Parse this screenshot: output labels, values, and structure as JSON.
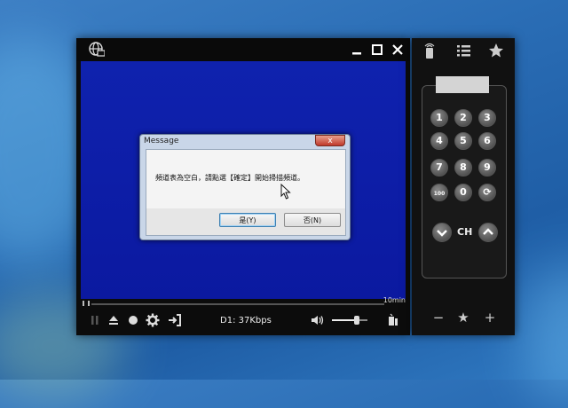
{
  "player": {
    "title_icon": "globe-tv-icon",
    "window_buttons": [
      "minimize-icon",
      "maximize-icon",
      "close-icon"
    ],
    "duration_label": "10min",
    "bitrate": "D1: 37Kbps",
    "seek_progress": 0.0,
    "volume_level": 0.7
  },
  "dialog": {
    "title": "Message",
    "close_label": "x",
    "message": "頻道表為空白，請點選【確定】開始掃描頻道。",
    "yes_label": "是(Y)",
    "no_label": "否(N)"
  },
  "remote": {
    "top_icons": [
      "remote-icon",
      "list-icon",
      "star-icon"
    ],
    "keys": [
      "1",
      "2",
      "3",
      "4",
      "5",
      "6",
      "7",
      "8",
      "9",
      "100",
      "0",
      "⟳"
    ],
    "ch_label": "CH",
    "bottom_labels": [
      "−",
      "★",
      "+"
    ]
  },
  "colors": {
    "video_blue": "#0f22ae",
    "desktop_blue": "#2a6db5",
    "window_black": "#0c0c0c"
  }
}
